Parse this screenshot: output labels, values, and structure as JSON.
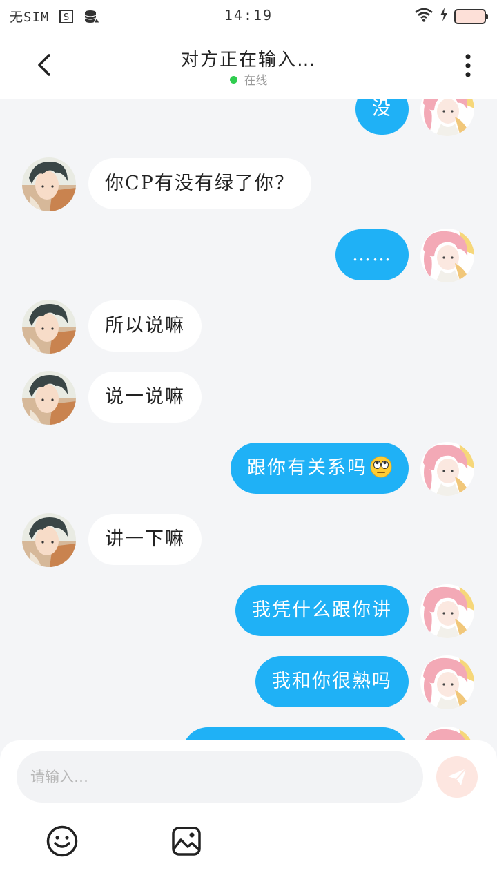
{
  "status_bar": {
    "sim": "无SIM",
    "time": "14:19"
  },
  "header": {
    "title": "对方正在输入…",
    "status": "在线",
    "back_icon": "chevron-left-icon",
    "more_icon": "more-vertical-icon"
  },
  "messages": [
    {
      "side": "right",
      "text": "没"
    },
    {
      "side": "left",
      "text": "你CP有没有绿了你？"
    },
    {
      "side": "right",
      "text": "……"
    },
    {
      "side": "left",
      "text": "所以说嘛"
    },
    {
      "side": "left",
      "text": "说一说嘛"
    },
    {
      "side": "right",
      "text": "跟你有关系吗",
      "emoji": "eye-roll-emoji"
    },
    {
      "side": "left",
      "text": "讲一下嘛"
    },
    {
      "side": "right",
      "text": "我凭什么跟你讲"
    },
    {
      "side": "right",
      "text": "我和你很熟吗"
    },
    {
      "side": "right",
      "text": ""
    }
  ],
  "input": {
    "placeholder": "请输入…",
    "value": ""
  },
  "colors": {
    "outgoing_bubble": "#1fb1f6",
    "incoming_bubble": "#ffffff",
    "online_dot": "#2fcd4f",
    "send_button": "#fde6e0"
  },
  "icons": {
    "send": "send-icon",
    "emoji": "smiley-icon",
    "image": "image-icon"
  }
}
